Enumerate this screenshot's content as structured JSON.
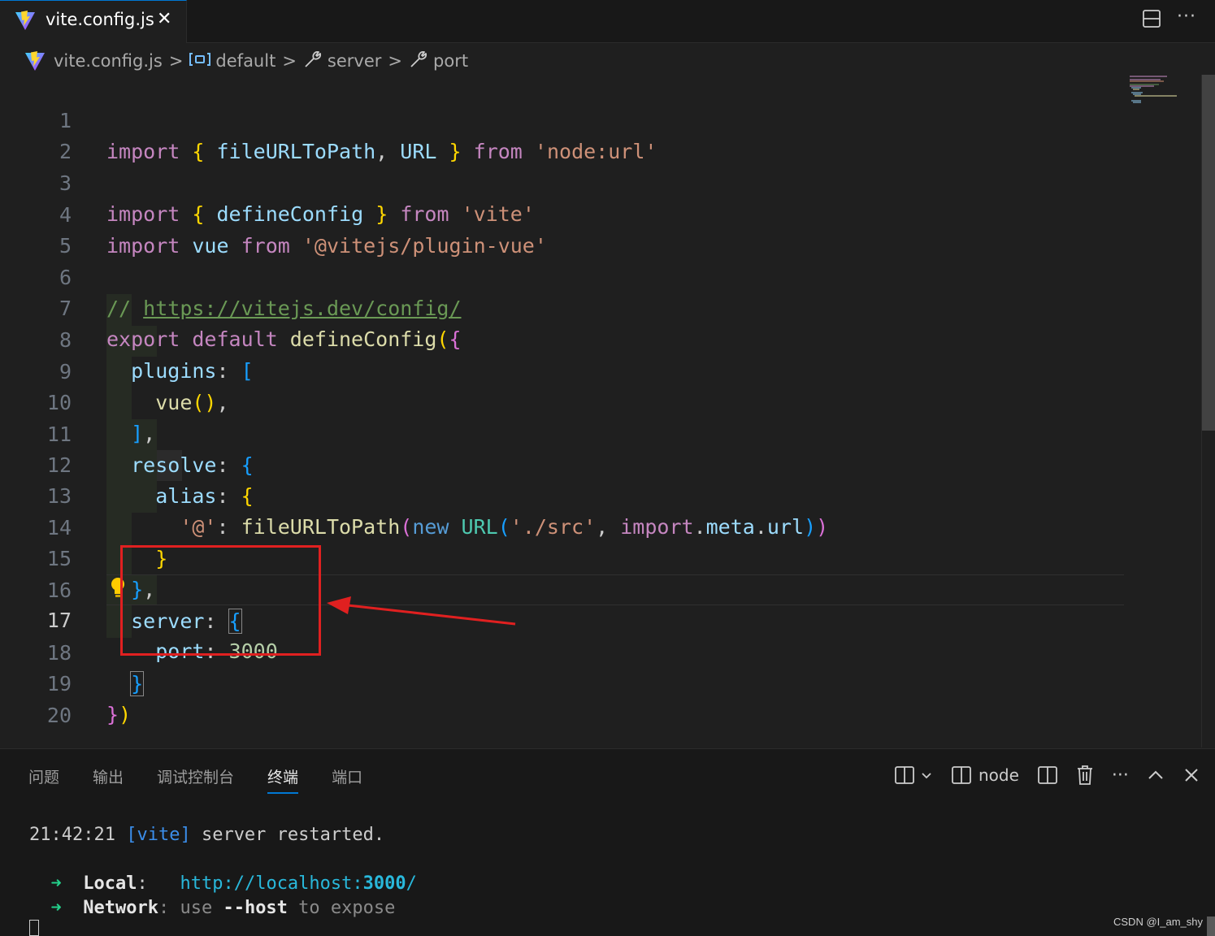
{
  "tab": {
    "title": "vite.config.js",
    "close": "✕",
    "icon": "vite-logo-icon"
  },
  "breadcrumb": {
    "file": "vite.config.js",
    "items": [
      {
        "icon": "symbol-variable-icon",
        "label": "default"
      },
      {
        "icon": "wrench-icon",
        "label": "server"
      },
      {
        "icon": "wrench-icon",
        "label": "port"
      }
    ],
    "separator": ">"
  },
  "editor": {
    "active_line": 17,
    "line_numbers": [
      "1",
      "2",
      "3",
      "4",
      "5",
      "6",
      "7",
      "8",
      "9",
      "10",
      "11",
      "12",
      "13",
      "14",
      "15",
      "16",
      "17",
      "18",
      "19",
      "20"
    ]
  },
  "code": {
    "l1": [
      "import",
      "{",
      "fileURLToPath",
      ",",
      "URL",
      "}",
      "from",
      "'node:url'"
    ],
    "l3": [
      "import",
      "{",
      "defineConfig",
      "}",
      "from",
      "'vite'"
    ],
    "l4": [
      "import",
      "vue",
      "from",
      "'@vitejs/plugin-vue'"
    ],
    "l6": [
      "//",
      "https://vitejs.dev/config/"
    ],
    "l7": [
      "export",
      "default",
      "defineConfig",
      "(",
      "{"
    ],
    "l8": [
      "plugins",
      ":",
      "["
    ],
    "l9": [
      "vue",
      "()",
      ","
    ],
    "l10": [
      "]",
      ","
    ],
    "l11": [
      "resolve",
      ":",
      "{"
    ],
    "l12": [
      "alias",
      ":",
      "{"
    ],
    "l13": [
      "'@'",
      ":",
      "fileURLToPath",
      "(",
      "new",
      "URL",
      "(",
      "'./src'",
      ",",
      "import",
      ".",
      "meta",
      ".",
      "url",
      ")",
      ")"
    ],
    "l14": [
      "}"
    ],
    "l15": [
      "}",
      ","
    ],
    "l16": [
      "server",
      ":",
      "{"
    ],
    "l17": [
      "port",
      ":",
      "3000"
    ],
    "l18": [
      "}"
    ],
    "l19": [
      "}",
      ")"
    ]
  },
  "panel": {
    "tabs": [
      "问题",
      "输出",
      "调试控制台",
      "终端",
      "端口"
    ],
    "active_tab": "终端",
    "terminal_name": "node"
  },
  "terminal": {
    "time": "21:42:21",
    "tag": "[vite]",
    "message": "server restarted.",
    "arrow": "➜",
    "local_label": "Local",
    "local_colon": ":",
    "local_url_prefix": "http://localhost:",
    "local_port": "3000",
    "local_url_suffix": "/",
    "network_label": "Network",
    "network_text": ": use ",
    "network_flag": "--host",
    "network_tail": " to expose"
  },
  "watermark": "CSDN @I_am_shy",
  "colors": {
    "annotation": "#e02020",
    "accent": "#0078d4"
  }
}
